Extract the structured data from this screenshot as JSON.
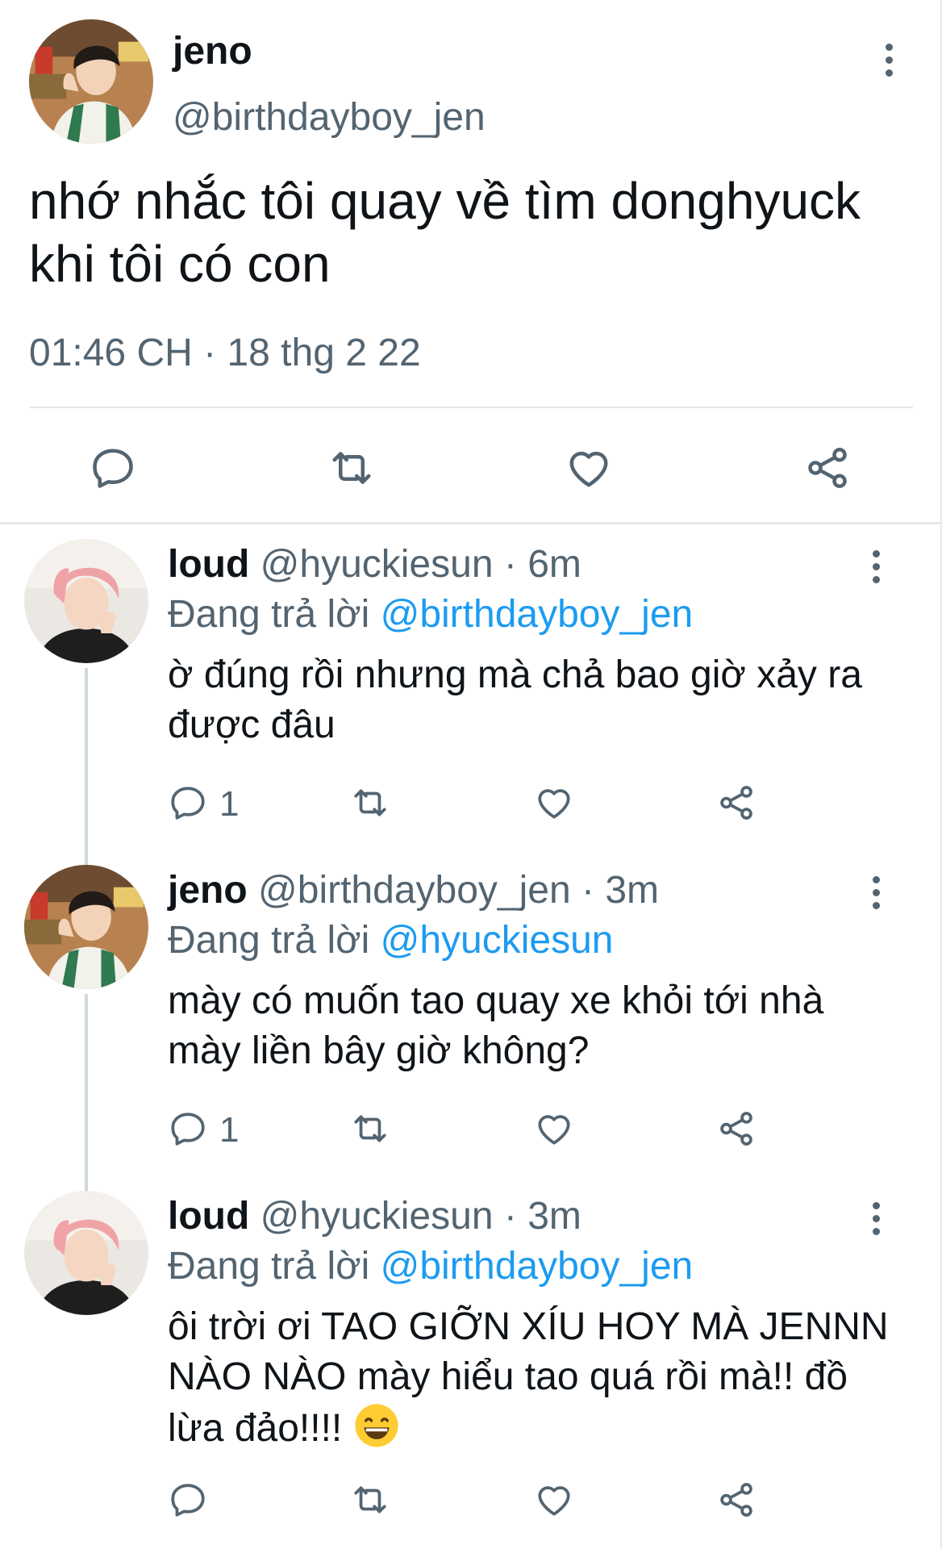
{
  "main_tweet": {
    "name": "jeno",
    "handle": "@birthdayboy_jen",
    "text": "nhớ nhắc tôi quay về tìm donghyuck khi tôi có con",
    "time": "01:46 CH",
    "separator": "·",
    "date": "18 thg 2 22",
    "actions": [
      "reply-icon",
      "retweet-icon",
      "like-icon",
      "share-icon"
    ]
  },
  "replies": [
    {
      "name": "loud",
      "handle": "@hyuckiesun",
      "separator": "·",
      "time": "6m",
      "replying_label": "Đang trả lời",
      "replying_to": "@birthdayboy_jen",
      "text": "ờ đúng rồi nhưng mà chả bao giờ xảy ra được đâu",
      "reply_count": "1"
    },
    {
      "name": "jeno",
      "handle": "@birthdayboy_jen",
      "separator": "·",
      "time": "3m",
      "replying_label": "Đang trả lời",
      "replying_to": "@hyuckiesun",
      "text": "mày có muốn tao quay xe khỏi tới nhà mày liền bây giờ không?",
      "reply_count": "1"
    },
    {
      "name": "loud",
      "handle": "@hyuckiesun",
      "separator": "·",
      "time": "3m",
      "replying_label": "Đang trả lời",
      "replying_to": "@birthdayboy_jen",
      "text": "ôi trời ơi TAO GIỠN XÍU HOY MÀ JENNN NÀO NÀO mày hiểu tao quá rồi mà!! đồ lừa đảo!!!! ",
      "text_emoji": "grinning-face-emoji",
      "reply_count": ""
    }
  ],
  "colors": {
    "primary_text": "#0f1419",
    "secondary_text": "#536471",
    "link": "#1d9bf0",
    "divider": "#e6e9ec",
    "thread_line": "#cfd9de"
  }
}
